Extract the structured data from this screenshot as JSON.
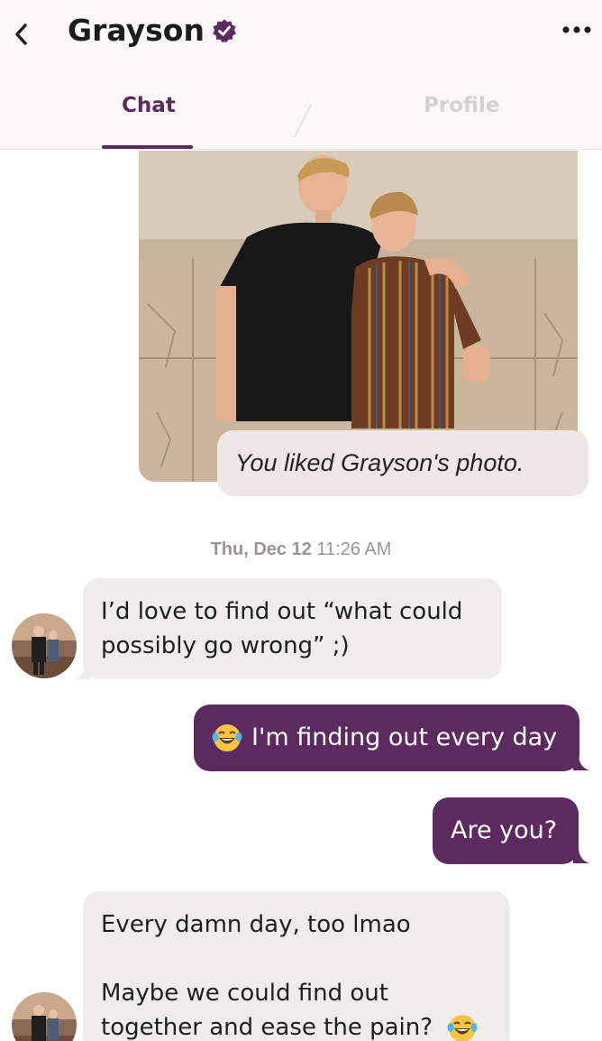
{
  "header": {
    "back_icon": "chevron-left-icon",
    "title": "Grayson",
    "verified_icon": "verified-badge-icon",
    "more_icon": "more-horizontal-icon"
  },
  "tabs": [
    {
      "label": "Chat",
      "active": true
    },
    {
      "label": "Profile",
      "active": false
    }
  ],
  "liked_photo": {
    "caption": "You liked Grayson's photo."
  },
  "timestamp": {
    "day": "Thu, Dec 12",
    "time": "11:26 AM"
  },
  "messages": [
    {
      "direction": "incoming",
      "lines": [
        "I’d love to find out “what could",
        "possibly go wrong” ;)"
      ]
    },
    {
      "direction": "outgoing",
      "emoji": "laughing-tears-emoji",
      "text": "I'm finding out every day"
    },
    {
      "direction": "outgoing",
      "text": "Are you?"
    },
    {
      "direction": "incoming",
      "lines": [
        "Every damn day, too lmao",
        "",
        "Maybe we could find out",
        "together and ease the pain?"
      ],
      "emoji": "laughing-tears-emoji"
    }
  ],
  "colors": {
    "accent": "#5c2a5e",
    "incoming_bubble": "#efedec",
    "liked_bubble": "#efe7e5"
  }
}
